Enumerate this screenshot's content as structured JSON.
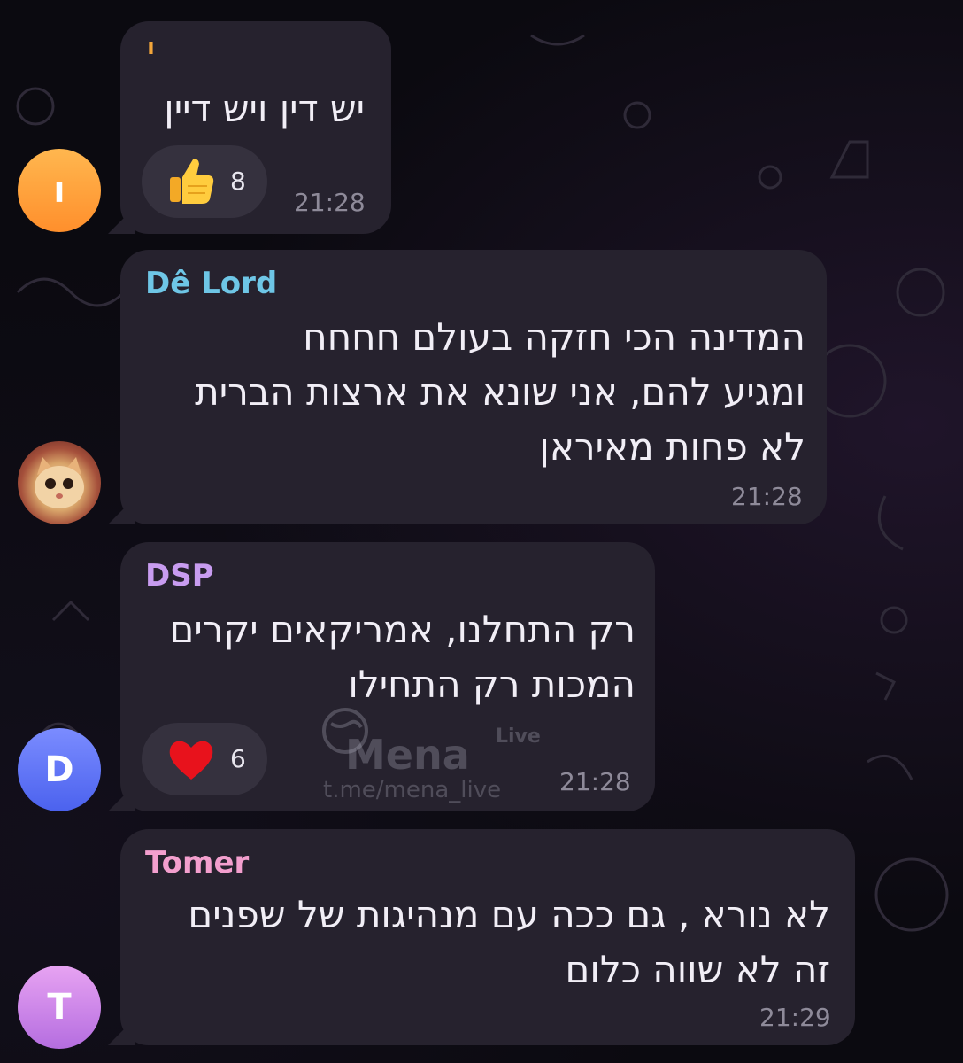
{
  "colors": {
    "bubble": "#26222e",
    "reaction_pill": "#35313e",
    "timestamp": "#8e8a99",
    "sender_delord": "#6ec6e6",
    "sender_dsp": "#c89cf0",
    "sender_tomer": "#f39fce",
    "sender_first": "#f2a53a"
  },
  "messages": [
    {
      "sender": "ו",
      "avatar_letter": "ו",
      "text": "יש דין ויש דיין",
      "time": "21:28",
      "reaction": {
        "icon": "thumbs-up-icon",
        "count": "8"
      }
    },
    {
      "sender": "Dê Lord",
      "avatar_letter": "",
      "text": "המדינה הכי חזקה בעולם חחחח\nומגיע להם, אני שונא את ארצות הברית\nלא פחות מאיראן",
      "time": "21:28"
    },
    {
      "sender": "DSP",
      "avatar_letter": "D",
      "text": "רק התחלנו, אמריקאים יקרים\nהמכות רק התחילו",
      "time": "21:28",
      "reaction": {
        "icon": "heart-icon",
        "count": "6"
      }
    },
    {
      "sender": "Tomer",
      "avatar_letter": "T",
      "text": "לא נורא , גם ככה עם מנהיגות של שפנים\nזה לא שווה כלום",
      "time": "21:29"
    }
  ],
  "watermark": {
    "brand": "Mena",
    "badge": "Live",
    "url": "t.me/mena_live"
  }
}
